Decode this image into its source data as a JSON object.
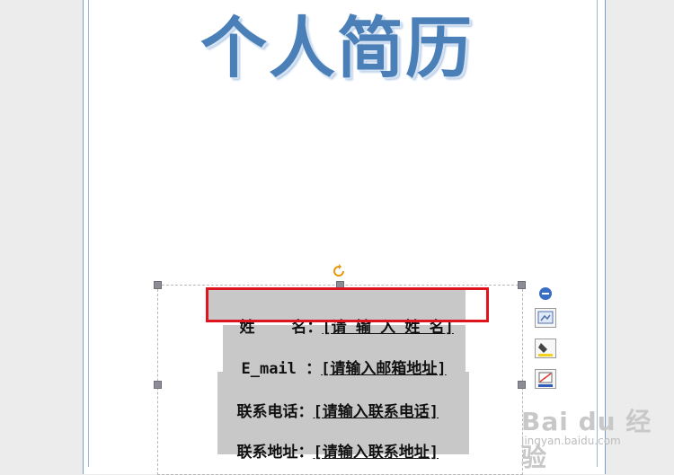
{
  "document": {
    "title": "个人简历",
    "fields": [
      {
        "label": "姓    名：",
        "value": "[请 输 入 姓 名]"
      },
      {
        "label": "E_mail ：",
        "value": "[请输入邮箱地址]"
      },
      {
        "label": "联系电话：",
        "value": "[请输入联系电话]"
      },
      {
        "label": "联系地址：",
        "value": "[请输入联系地址]"
      }
    ]
  },
  "toolbar": {
    "buttons": [
      "layout-icon",
      "fill-icon",
      "outline-icon"
    ]
  },
  "watermark": {
    "main": "Bai du 经验",
    "sub": "jingyan.baidu.com"
  },
  "colors": {
    "title": "#4a7fb8",
    "highlight": "#e0141e",
    "field_background": "#c8c8c8"
  }
}
